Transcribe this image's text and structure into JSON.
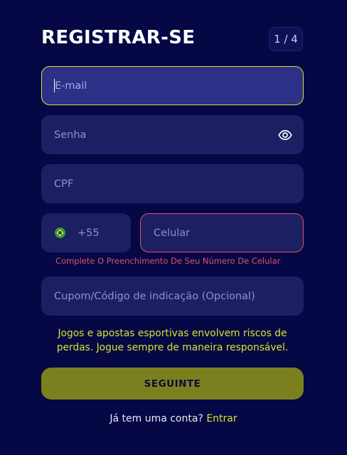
{
  "header": {
    "title": "REGISTRAR-SE",
    "step": "1 / 4"
  },
  "form": {
    "email_placeholder": "E-mail",
    "password_placeholder": "Senha",
    "cpf_placeholder": "CPF",
    "phone_country_code": "+55",
    "phone_placeholder": "Celular",
    "phone_error": "Complete O Preenchimento De Seu Número De Celular",
    "coupon_placeholder": "Cupom/Código de indicação (Opcional)"
  },
  "disclaimer": "Jogos e apostas esportivas envolvem riscos de perdas. Jogue sempre de maneira responsável.",
  "submit_label": "SEGUINTE",
  "footer": {
    "question": "Já tem uma conta?",
    "login_label": "Entrar"
  },
  "colors": {
    "background": "#050845",
    "field": "#1c2063",
    "accent": "#d6e233",
    "error": "#e04f62",
    "button": "#7b801f"
  }
}
